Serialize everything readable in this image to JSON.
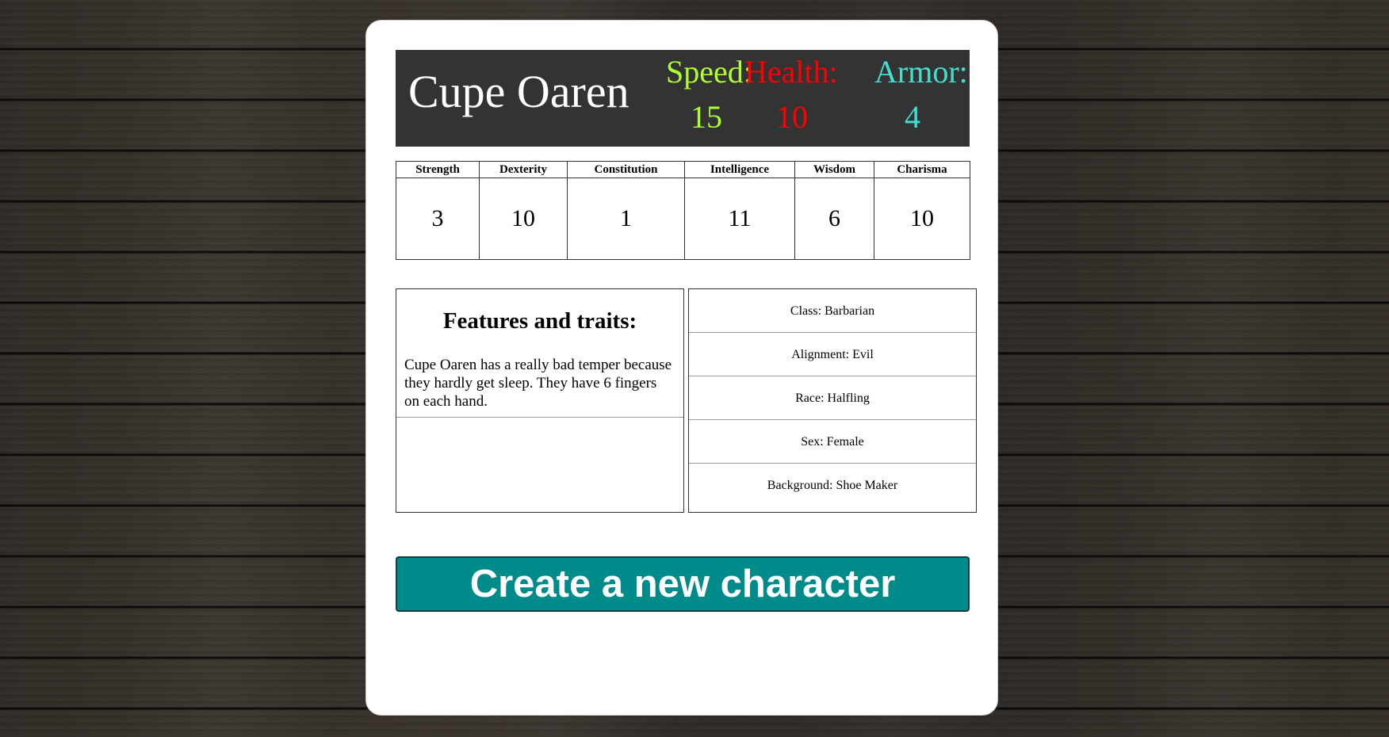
{
  "character": {
    "name": "Cupe Oaren"
  },
  "stats": {
    "speed": {
      "label": "Speed:",
      "value": "15",
      "color": "#adff2f"
    },
    "health": {
      "label": "Health:",
      "value": "10",
      "color": "#ff0000"
    },
    "armor": {
      "label": "Armor:",
      "value": "4",
      "color": "#40e0d0"
    }
  },
  "abilities": [
    {
      "label": "Strength",
      "value": "3"
    },
    {
      "label": "Dexterity",
      "value": "10"
    },
    {
      "label": "Constitution",
      "value": "1"
    },
    {
      "label": "Intelligence",
      "value": "11"
    },
    {
      "label": "Wisdom",
      "value": "6"
    },
    {
      "label": "Charisma",
      "value": "10"
    }
  ],
  "features": {
    "title": "Features and traits:",
    "text": "Cupe Oaren has a really bad temper because they hardly get sleep. They have 6 fingers on each hand."
  },
  "details": [
    "Class: Barbarian",
    "Alignment: Evil",
    "Race: Halfling",
    "Sex: Female",
    "Background: Shoe Maker"
  ],
  "actions": {
    "create_label": "Create a new character",
    "button_color": "#008b8b"
  }
}
